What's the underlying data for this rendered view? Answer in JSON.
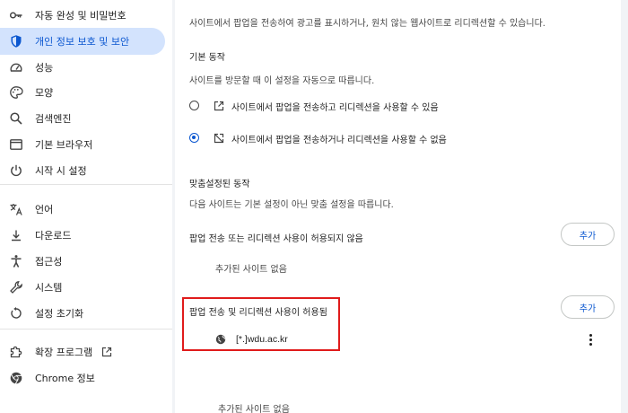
{
  "sidebar": {
    "items": [
      {
        "label": "자동 완성 및 비밀번호",
        "icon": "key-icon"
      },
      {
        "label": "개인 정보 보호 및 보안",
        "icon": "shield-icon",
        "active": true
      },
      {
        "label": "성능",
        "icon": "speedometer-icon"
      },
      {
        "label": "모양",
        "icon": "palette-icon"
      },
      {
        "label": "검색엔진",
        "icon": "search-icon"
      },
      {
        "label": "기본 브라우저",
        "icon": "browser-window-icon"
      },
      {
        "label": "시작 시 설정",
        "icon": "power-icon"
      },
      {
        "label": "언어",
        "icon": "translate-icon"
      },
      {
        "label": "다운로드",
        "icon": "download-icon"
      },
      {
        "label": "접근성",
        "icon": "accessibility-icon"
      },
      {
        "label": "시스템",
        "icon": "wrench-icon"
      },
      {
        "label": "설정 초기화",
        "icon": "reset-icon"
      },
      {
        "label": "확장 프로그램",
        "icon": "puzzle-icon"
      },
      {
        "label": "Chrome 정보",
        "icon": "chrome-icon"
      }
    ]
  },
  "main": {
    "intro": "사이트에서 팝업을 전송하여 광고를 표시하거나, 원치 않는 웹사이트로 리디렉션할 수 있습니다.",
    "default_behavior": {
      "title": "기본 동작",
      "desc": "사이트를 방문할 때 이 설정을 자동으로 따릅니다.",
      "options": [
        {
          "label": "사이트에서 팝업을 전송하고 리디렉션을 사용할 수 있음",
          "checked": false,
          "icon": "open-in-new-icon"
        },
        {
          "label": "사이트에서 팝업을 전송하거나 리디렉션을 사용할 수 없음",
          "checked": true,
          "icon": "popup-blocked-icon"
        }
      ]
    },
    "custom_behavior": {
      "title": "맞춤설정된 동작",
      "desc": "다음 사이트는 기본 설정이 아닌 맞춤 설정을 따릅니다."
    },
    "blocked_section": {
      "title": "팝업 전송 또는 리디렉션 사용이 허용되지 않음",
      "add_label": "추가",
      "empty": "추가된 사이트 없음"
    },
    "allowed_section": {
      "title": "팝업 전송 및 리디렉션 사용이 허용됨",
      "add_label": "추가",
      "site": "[*.]wdu.ac.kr"
    },
    "bottom_empty": "추가된 사이트 없음"
  },
  "colors": {
    "accent": "#0b57d0",
    "active_bg": "#d3e3fd",
    "highlight": "#e01b1b"
  }
}
